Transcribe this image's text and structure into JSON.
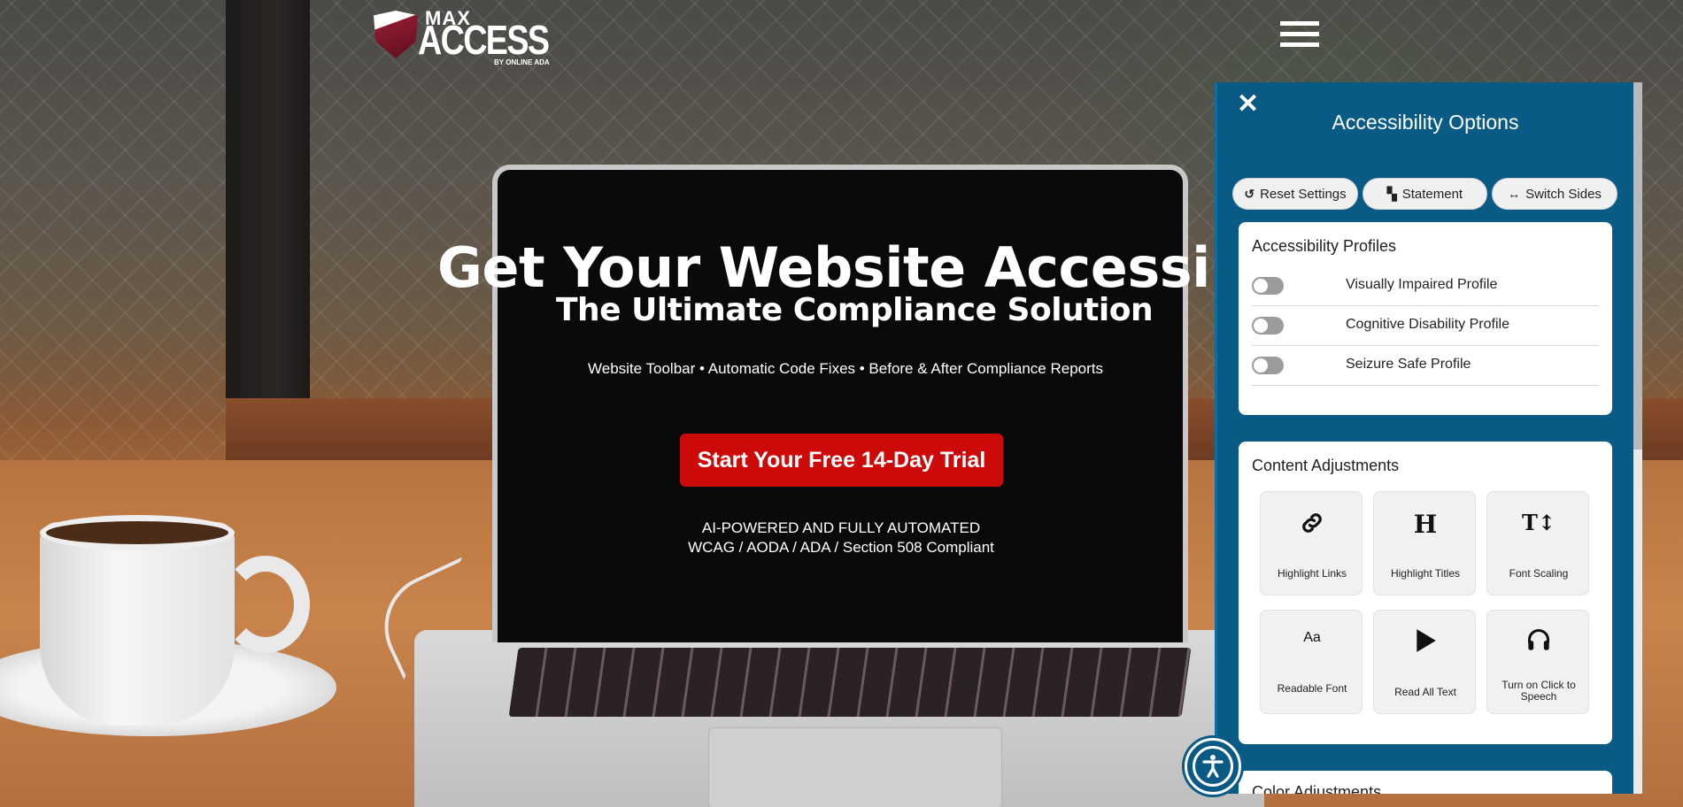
{
  "brand": {
    "top": "MAX",
    "main": "ACCESS",
    "byline": "BY ONLINE ADA"
  },
  "hero": {
    "title": "Get Your Website Accessible",
    "subtitle": "The Ultimate Compliance Solution",
    "features": "Website Toolbar • Automatic Code Fixes • Before & After Compliance Reports",
    "cta": "Start Your Free 14-Day Trial",
    "tagline_1": "AI-POWERED AND FULLY AUTOMATED",
    "tagline_2": "WCAG / AODA / ADA / Section 508 Compliant"
  },
  "panel": {
    "title": "Accessibility Options",
    "buttons": {
      "reset": "Reset Settings",
      "statement": "Statement",
      "switch": "Switch Sides"
    },
    "profiles": {
      "heading": "Accessibility Profiles",
      "items": [
        {
          "label": "Visually Impaired Profile",
          "enabled": false
        },
        {
          "label": "Cognitive Disability Profile",
          "enabled": false
        },
        {
          "label": "Seizure Safe Profile",
          "enabled": false
        }
      ]
    },
    "content": {
      "heading": "Content Adjustments",
      "tiles": [
        {
          "label": "Highlight Links",
          "icon": "link-icon"
        },
        {
          "label": "Highlight Titles",
          "icon": "heading-icon"
        },
        {
          "label": "Font Scaling",
          "icon": "font-scaling-icon"
        },
        {
          "label": "Readable Font",
          "icon": "readable-font-icon",
          "glyph": "Aa"
        },
        {
          "label": "Read All Text",
          "icon": "play-icon"
        },
        {
          "label": "Turn on Click to Speech",
          "icon": "headphones-icon"
        }
      ]
    },
    "next_section_heading": "Color Adjustments"
  },
  "colors": {
    "panel": "#0a5a86",
    "cta": "#cc0a0a"
  }
}
